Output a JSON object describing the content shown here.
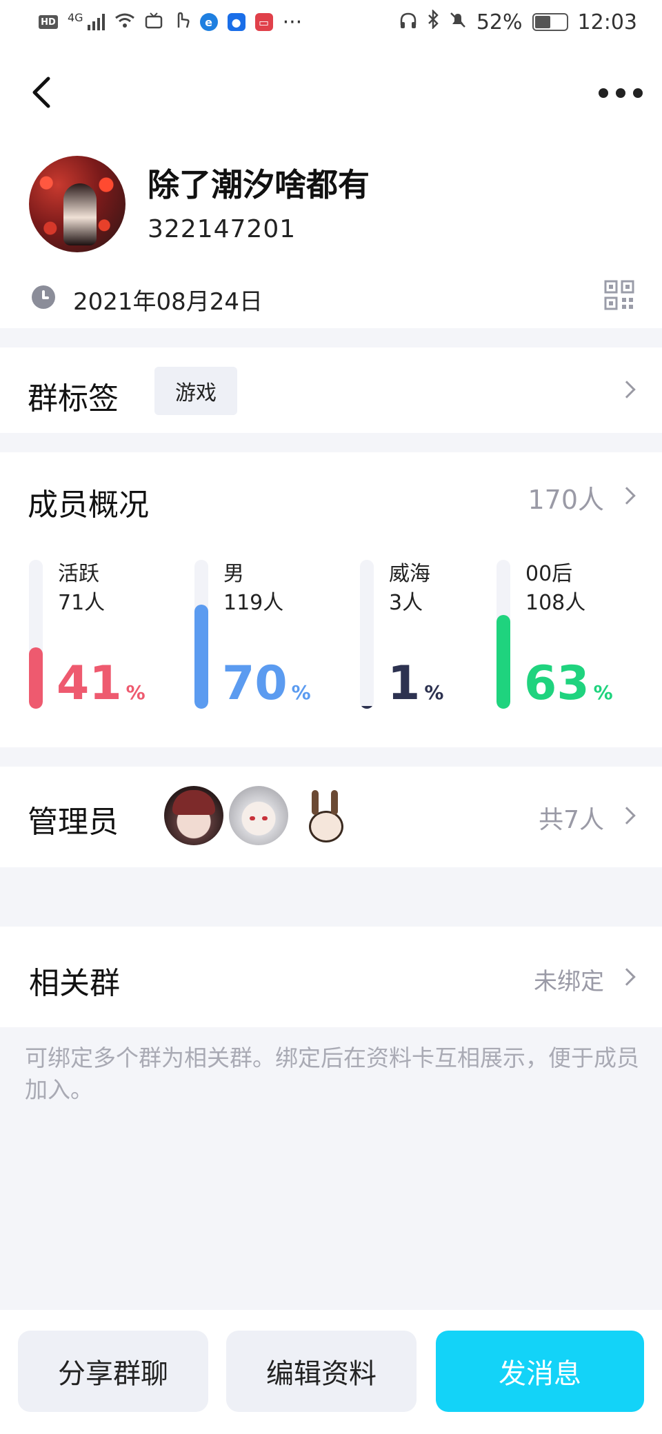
{
  "status_bar": {
    "network": "4G",
    "battery": "52%",
    "time": "12:03"
  },
  "header": {
    "group_name": "除了潮汐啥都有",
    "group_id": "322147201",
    "created_date": "2021年08月24日"
  },
  "tags": {
    "title": "群标签",
    "items": [
      "游戏"
    ]
  },
  "members": {
    "title": "成员概况",
    "count": "170人",
    "stats": [
      {
        "label": "活跃",
        "count": "71人",
        "percent": "41",
        "unit": "%",
        "fraction": 0.41,
        "color": "#ee5a6f"
      },
      {
        "label": "男",
        "count": "119人",
        "percent": "70",
        "unit": "%",
        "fraction": 0.7,
        "color": "#5b9bf0"
      },
      {
        "label": "威海",
        "count": "3人",
        "percent": "1",
        "unit": "%",
        "fraction": 0.01,
        "color": "#2d3250"
      },
      {
        "label": "00后",
        "count": "108人",
        "percent": "63",
        "unit": "%",
        "fraction": 0.63,
        "color": "#1fd37e"
      }
    ]
  },
  "admins": {
    "title": "管理员",
    "count": "共7人"
  },
  "related": {
    "title": "相关群",
    "status": "未绑定",
    "description": "可绑定多个群为相关群。绑定后在资料卡互相展示，便于成员加入。"
  },
  "actions": {
    "share": "分享群聊",
    "edit": "编辑资料",
    "send": "发消息"
  }
}
